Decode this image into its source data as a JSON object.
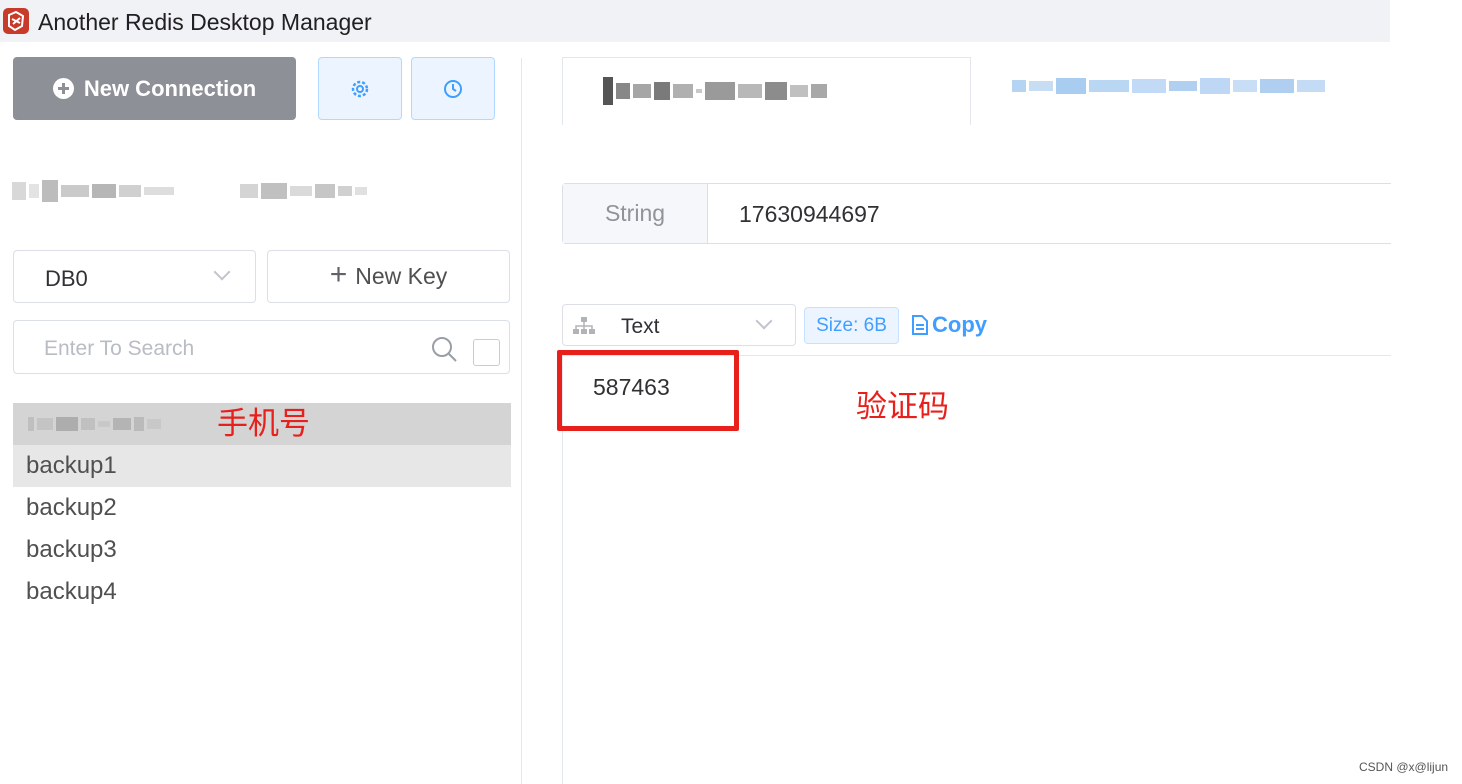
{
  "window": {
    "title": "Another Redis Desktop Manager",
    "logo_icon": "redis-desktop-manager-logo-icon"
  },
  "sidebar": {
    "new_connection_label": "New Connection",
    "settings_icon": "gear-icon",
    "history_icon": "clock-icon",
    "db_select_value": "DB0",
    "new_key_label": "New Key",
    "search_placeholder": "Enter To Search",
    "keys": [
      {
        "label": "",
        "blurred": true
      },
      {
        "label": "backup1"
      },
      {
        "label": "backup2"
      },
      {
        "label": "backup3"
      },
      {
        "label": "backup4"
      }
    ],
    "phone_annotation": "手机号"
  },
  "detail": {
    "type_label": "String",
    "key_value": "17630944697",
    "format_value": "Text",
    "size_tag": "Size: 6B",
    "copy_label": "Copy",
    "value": "587463",
    "code_annotation": "验证码"
  },
  "colors": {
    "annotation_red": "#e8201c",
    "primary_blue": "#409eff",
    "grey_button": "#8d9096"
  },
  "watermark": "CSDN @x@lijun"
}
